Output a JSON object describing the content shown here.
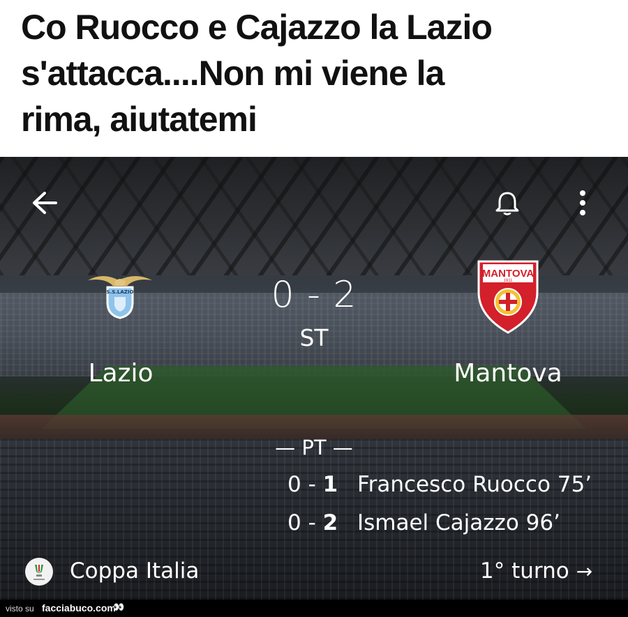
{
  "headline": {
    "line1": "Co Ruocco e Cajazzo la Lazio",
    "line2": "s'attacca....Non mi viene la",
    "line3": "rima, aiutatemi"
  },
  "match": {
    "score": "0 - 2",
    "period": "ST",
    "home_team": "Lazio",
    "away_team": "Mantova",
    "away_crest_text": "MANTOVA",
    "away_crest_year": "1911",
    "home_crest_text": "S.S.LAZIO",
    "half_label": "— PT —",
    "goals": [
      {
        "score_home": "0",
        "score_sep": " - ",
        "score_away": "1",
        "scorer": "Francesco Ruocco 75’"
      },
      {
        "score_home": "0",
        "score_sep": " - ",
        "score_away": "2",
        "scorer": "Ismael Cajazzo 96’"
      }
    ],
    "competition": "Coppa Italia",
    "round": "1° turno",
    "round_arrow": "→"
  },
  "icons": {
    "back": "back-arrow-icon",
    "notify": "bell-icon",
    "more": "more-vert-icon",
    "round_link": "arrow-right-icon"
  },
  "footer": {
    "lead": "visto su",
    "brand": "facciabuco.com",
    "eyes": "👀"
  },
  "colors": {
    "text_overlay": "#ffffff",
    "headline": "#111111",
    "mantova_red": "#d3202a"
  }
}
